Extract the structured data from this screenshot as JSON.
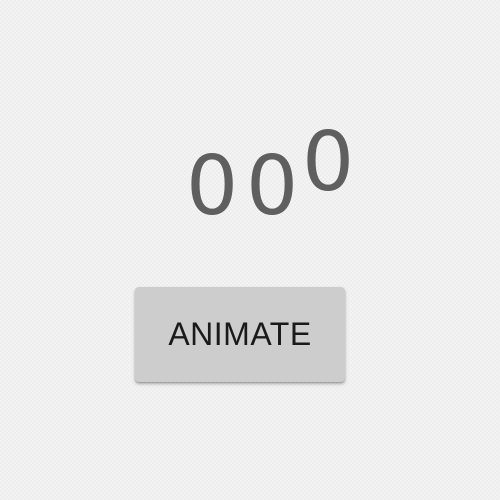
{
  "counter": {
    "digits": [
      "0",
      "0",
      "0"
    ]
  },
  "controls": {
    "animate_label": "ANIMATE"
  },
  "colors": {
    "background": "#f3f3f3",
    "digit_text": "#5f5f5f",
    "button_bg": "#cdcdcd",
    "button_text": "#1a1a1a"
  }
}
